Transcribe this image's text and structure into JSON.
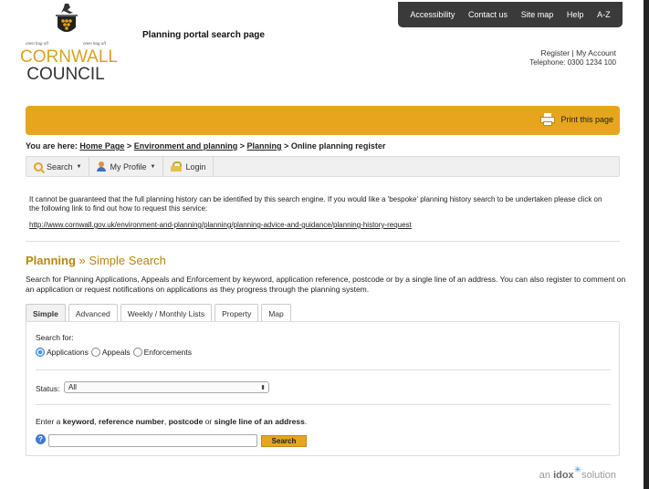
{
  "header": {
    "logo_line1": "CORNWALL",
    "logo_line2": "COUNCIL",
    "motto_left": "onen hag oll",
    "motto_right": "onen hag oll",
    "page_heading": "Planning portal search page",
    "account": {
      "register_label": "Register",
      "separator": "|",
      "my_account_label": "My Account",
      "telephone": "Telephone: 0300 1234 100"
    }
  },
  "topnav": {
    "items": [
      "Accessibility",
      "Contact us",
      "Site map",
      "Help",
      "A-Z"
    ]
  },
  "banner": {
    "print_label": "Print this page",
    "color": "#e6a51d"
  },
  "breadcrumb": {
    "prefix": "You are here:",
    "items": [
      "Home Page",
      "Environment and planning",
      "Planning",
      "Online planning register"
    ],
    "separator": ">"
  },
  "toolbar": {
    "search_label": "Search",
    "my_profile_label": "My Profile",
    "login_label": "Login"
  },
  "notice": {
    "text": "It cannot be guaranteed that the full planning history can be identified by this search engine.  If you would like a 'bespoke' planning history search to be undertaken please click on the following link to find out how to request this service:",
    "link": "http://www.cornwall.gov.uk/environment-and-planning/planning/planning-advice-and-guidance/planning-history-request"
  },
  "section": {
    "title_bold": "Planning",
    "title_sep": "»",
    "title_rest": "Simple Search",
    "description": "Search for Planning Applications, Appeals and Enforcement by keyword, application reference, postcode or by a single line of an address. You can also register to comment on an application or request notifications on applications as they progress through the planning system."
  },
  "tabs": [
    {
      "label": "Simple",
      "active": true
    },
    {
      "label": "Advanced",
      "active": false
    },
    {
      "label": "Weekly / Monthly Lists",
      "active": false
    },
    {
      "label": "Property",
      "active": false
    },
    {
      "label": "Map",
      "active": false
    }
  ],
  "form": {
    "search_for_label": "Search for:",
    "radios": [
      {
        "label": "Applications",
        "checked": true
      },
      {
        "label": "Appeals",
        "checked": false
      },
      {
        "label": "Enforcements",
        "checked": false
      }
    ],
    "status_label": "Status:",
    "status_value": "All",
    "status_arrow": "⬍",
    "enter_prefix": "Enter a ",
    "enter_b1": "keyword",
    "enter_c1": ", ",
    "enter_b2": "reference number",
    "enter_c2": ", ",
    "enter_b3": "postcode",
    "enter_c3": " or ",
    "enter_b4": "single line of an address",
    "enter_c4": ".",
    "help_glyph": "?",
    "search_value": "",
    "search_button_label": "Search"
  },
  "footer": {
    "idox_pre": "an ",
    "idox_bold": "idox",
    "idox_post": "solution"
  }
}
